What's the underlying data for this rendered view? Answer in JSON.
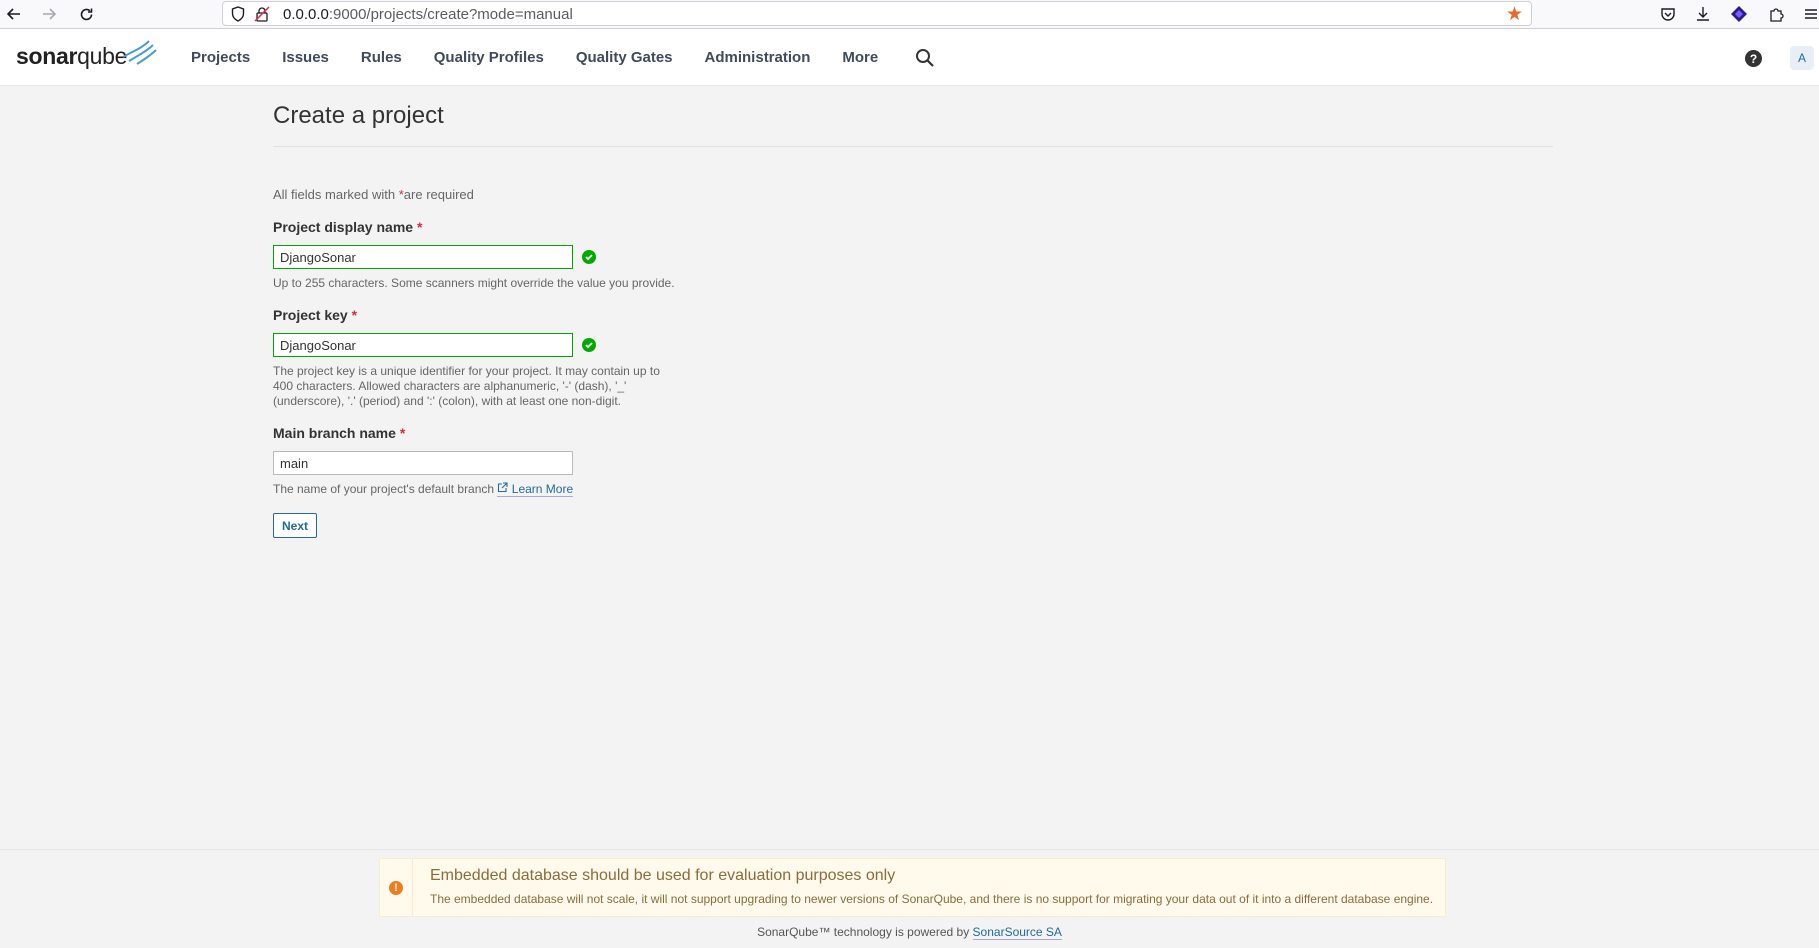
{
  "browser": {
    "url_host": "0.0.0.0",
    "url_path": ":9000/projects/create?mode=manual"
  },
  "nav": {
    "logo_text_bold": "sonar",
    "logo_text": "qube",
    "items": [
      {
        "label": "Projects"
      },
      {
        "label": "Issues"
      },
      {
        "label": "Rules"
      },
      {
        "label": "Quality Profiles"
      },
      {
        "label": "Quality Gates"
      },
      {
        "label": "Administration"
      },
      {
        "label": "More"
      }
    ],
    "help_label": "?",
    "avatar_label": "A"
  },
  "page": {
    "title": "Create a project",
    "required_prefix": "All fields marked with",
    "required_star": "*",
    "required_suffix": "are required"
  },
  "form": {
    "display_name": {
      "label": "Project display name",
      "star": "*",
      "value": "DjangoSonar",
      "help": "Up to 255 characters. Some scanners might override the value you provide."
    },
    "project_key": {
      "label": "Project key",
      "star": "*",
      "value": "DjangoSonar",
      "help_line1": "The project key is a unique identifier for your project. It may contain up to",
      "help_line2": "400 characters. Allowed characters are alphanumeric, '-' (dash), '_'",
      "help_line3": "(underscore), '.' (period) and ':' (colon), with at least one non-digit."
    },
    "main_branch": {
      "label": "Main branch name",
      "star": "*",
      "value": "main",
      "help": "The name of your project's default branch",
      "learn_more": "Learn More"
    },
    "next_label": "Next"
  },
  "footer": {
    "warning_title": "Embedded database should be used for evaluation purposes only",
    "warning_body": "The embedded database will not scale, it will not support upgrading to newer versions of SonarQube, and there is no support for migrating your data out of it into a different database engine.",
    "powered_text": "SonarQube™ technology is powered by",
    "powered_link": "SonarSource SA"
  }
}
